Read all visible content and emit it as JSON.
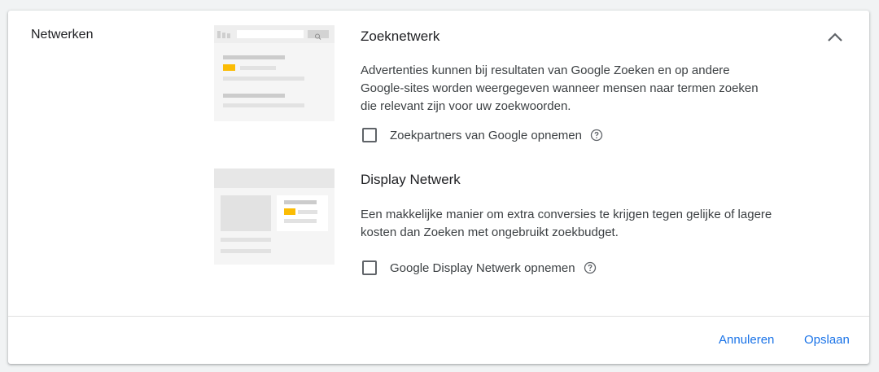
{
  "section": {
    "label": "Netwerken"
  },
  "networks": [
    {
      "title": "Zoeknetwerk",
      "description_lines": [
        "Advertenties kunnen bij resultaten van Google Zoeken en op andere",
        "Google-sites worden weergegeven wanneer mensen naar termen zoeken",
        "die relevant zijn voor uw zoekwoorden."
      ],
      "option_label": "Zoekpartners van Google opnemen",
      "option_checked": false
    },
    {
      "title": "Display Netwerk",
      "description_lines": [
        "Een makkelijke manier om extra conversies te krijgen tegen gelijke of lagere",
        "kosten dan Zoeken met ongebruikt zoekbudget."
      ],
      "option_label": "Google Display Netwerk opnemen",
      "option_checked": false
    }
  ],
  "actions": {
    "cancel_label": "Annuleren",
    "save_label": "Opslaan"
  },
  "icons": {
    "collapse": "chevron-up-icon",
    "help": "help-circle-icon",
    "search": "search-icon"
  },
  "colors": {
    "accent": "#1a73e8",
    "highlight": "#fbbc04",
    "placeholder": "#dadce0"
  }
}
